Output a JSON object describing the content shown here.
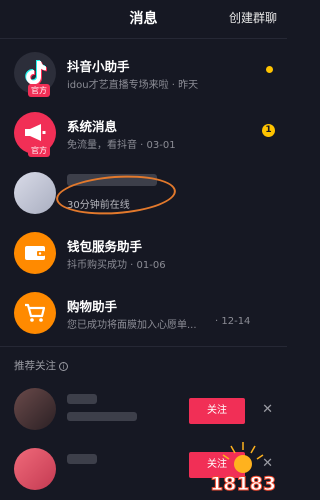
{
  "header": {
    "title": "消息",
    "create_group": "创建群聊"
  },
  "messages": [
    {
      "name": "抖音小助手",
      "sub": "idou才艺直播专场来啦 · 昨天",
      "badge": "官方",
      "icon": "tiktok-logo-icon",
      "indicator": "dot"
    },
    {
      "name": "系统消息",
      "sub": "免流量，看抖音 · 03-01",
      "badge": "官方",
      "icon": "megaphone-icon",
      "count": "1"
    },
    {
      "name": "",
      "sub": "30分钟前在线",
      "icon": "user-avatar"
    },
    {
      "name": "钱包服务助手",
      "sub": "抖币购买成功 · 01-06",
      "icon": "wallet-icon"
    },
    {
      "name": "购物助手",
      "sub": "您已成功将面膜加入心愿单...",
      "date": "· 12-14",
      "icon": "cart-icon"
    }
  ],
  "recommend": {
    "title": "推荐关注",
    "items": [
      {
        "follow_label": "关注"
      },
      {
        "follow_label": "关注"
      }
    ]
  },
  "watermark": "18183",
  "colors": {
    "background": "#161823",
    "accent": "#f12f56",
    "badge_yellow": "#ffc300",
    "icon_orange": "#ff8a00"
  }
}
